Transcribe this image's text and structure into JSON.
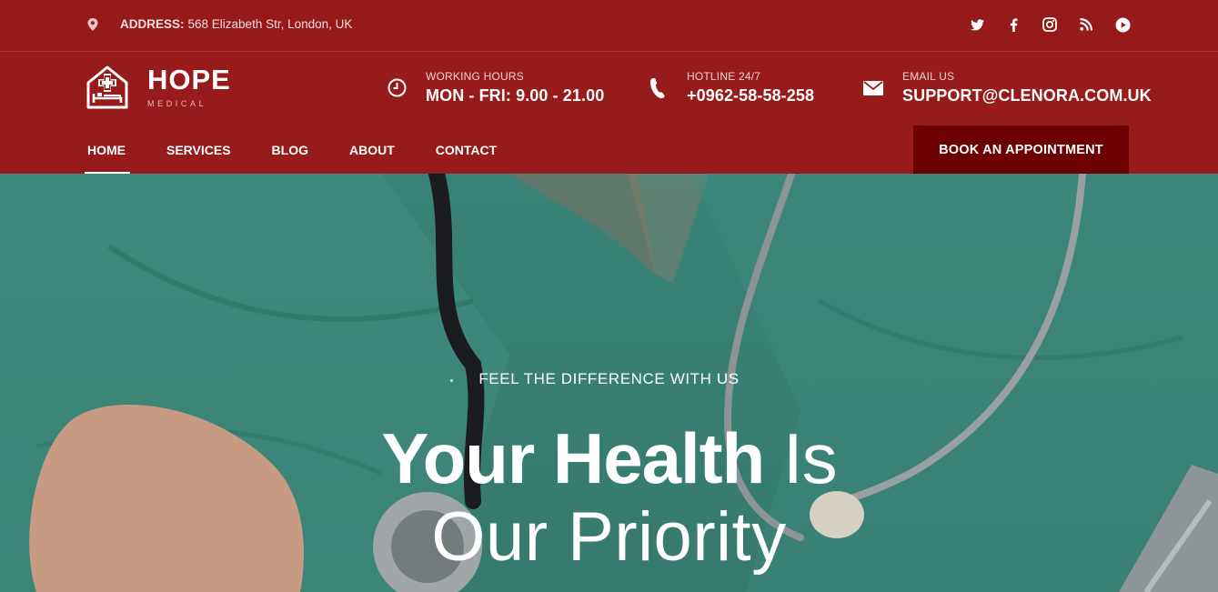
{
  "topbar": {
    "address_label": "ADDRESS:",
    "address_value": "568 Elizabeth Str, London, UK",
    "socials": [
      "twitter-icon",
      "facebook-icon",
      "instagram-icon",
      "rss-icon",
      "youtube-icon"
    ]
  },
  "header": {
    "brand": "HOPE",
    "brand_sub": "MEDICAL",
    "hours": {
      "label": "WORKING HOURS",
      "value": "MON - FRI: 9.00 - 21.00"
    },
    "hotline": {
      "label": "HOTLINE 24/7",
      "value": "+0962-58-58-258"
    },
    "email": {
      "label": "EMAIL US",
      "value": "SUPPORT@CLENORA.COM.UK"
    }
  },
  "nav": {
    "items": [
      "HOME",
      "SERVICES",
      "BLOG",
      "ABOUT",
      "CONTACT"
    ],
    "active": "HOME",
    "cta": "BOOK AN APPOINTMENT"
  },
  "hero": {
    "kicker": "FEEL THE DIFFERENCE WITH US",
    "title_bold": "Your Health",
    "title_light": "Is",
    "title_line2": "Our Priority"
  },
  "colors": {
    "brand_red": "#981b1b",
    "cta_dark": "#6d0000",
    "hero_teal": "#4a9a8c"
  }
}
